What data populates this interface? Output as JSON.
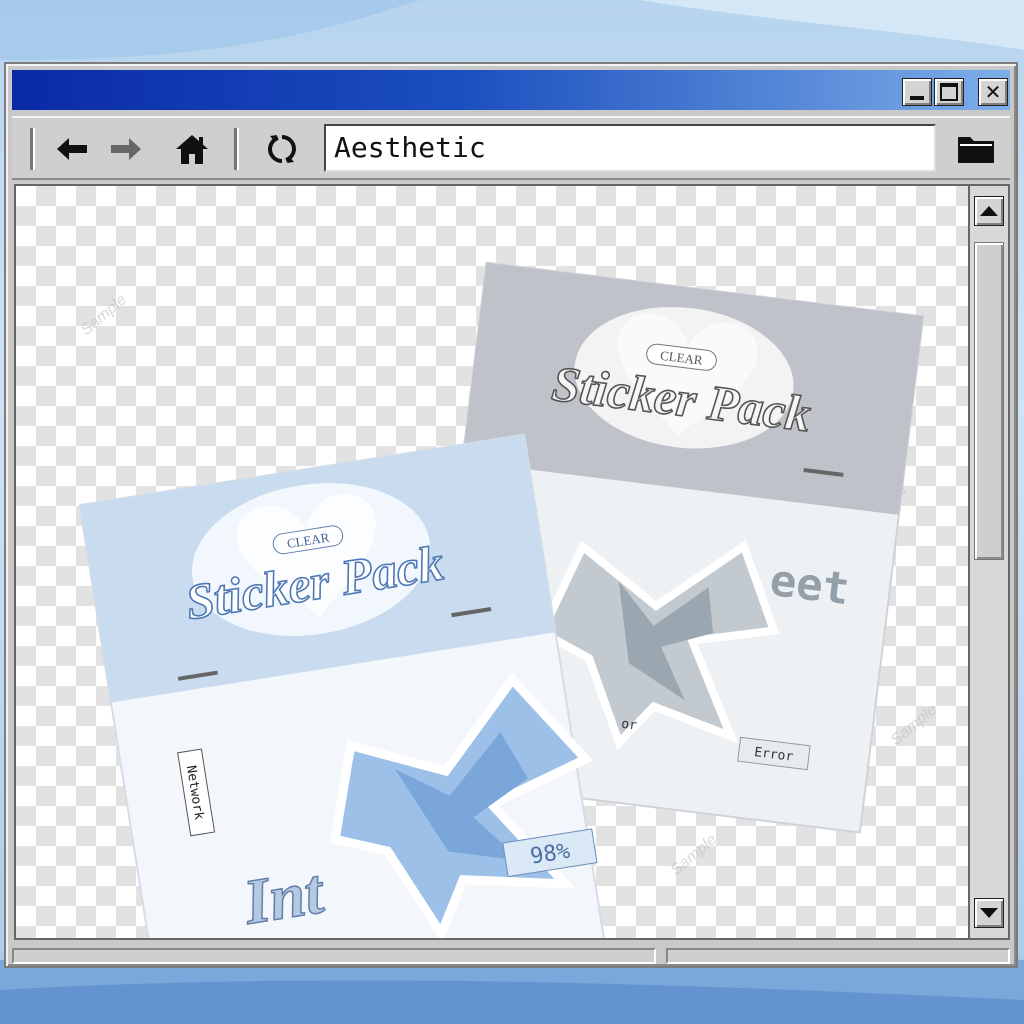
{
  "window": {
    "title": "",
    "controls": {
      "minimize": "_",
      "maximize": "□",
      "close": "✕"
    }
  },
  "toolbar": {
    "icons": [
      "back-arrow-icon",
      "forward-arrow-icon",
      "home-icon",
      "refresh-icon",
      "folder-icon"
    ],
    "address_value": "Aesthetic"
  },
  "content": {
    "watermark": "Sample",
    "packs": [
      {
        "header_badge": "CLEAR",
        "header_title": "Sticker Pack",
        "stickers": [
          "Network",
          "98%",
          "Int"
        ]
      },
      {
        "header_badge": "CLEAR",
        "header_title": "Sticker Pack",
        "stickers": [
          "Error",
          "eet",
          "or"
        ]
      }
    ]
  },
  "colors": {
    "titlebar_start": "#0a2aa8",
    "titlebar_end": "#7eaee8",
    "window_grey": "#c9c9c9",
    "pack_blue": "#9cc0e8",
    "pack_silver": "#c9ccd2"
  }
}
